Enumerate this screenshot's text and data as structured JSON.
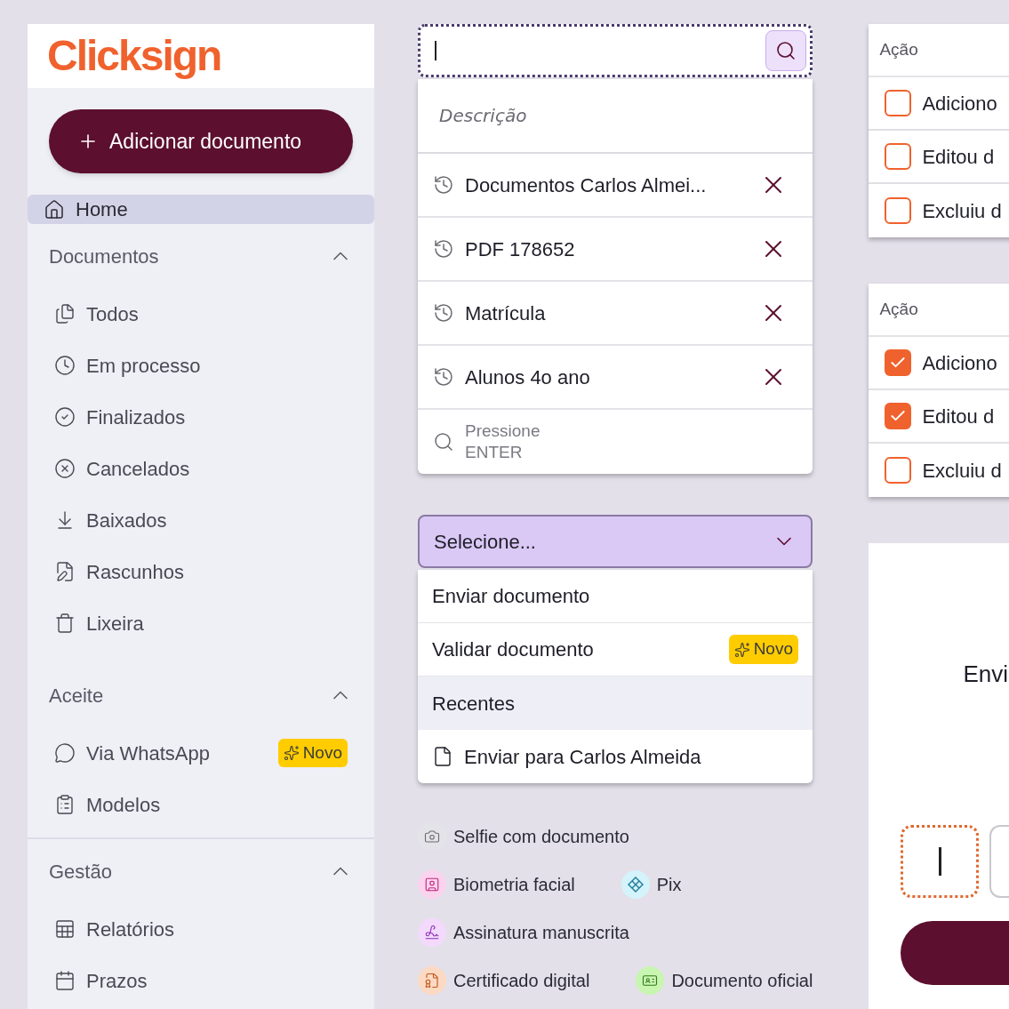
{
  "sidebar": {
    "logo": "Clicksign",
    "add_button": "Adicionar documento",
    "home": {
      "label": "Home",
      "selected": true
    },
    "sections": [
      {
        "title": "Documentos",
        "expanded": true,
        "items": [
          {
            "label": "Todos",
            "selected": false
          },
          {
            "label": "Em processo",
            "selected": false
          },
          {
            "label": "Finalizados",
            "selected": false
          },
          {
            "label": "Cancelados",
            "selected": false
          },
          {
            "label": "Baixados",
            "selected": false
          },
          {
            "label": "Rascunhos",
            "selected": false
          },
          {
            "label": "Lixeira",
            "selected": false
          }
        ]
      },
      {
        "title": "Aceite",
        "expanded": true,
        "items": [
          {
            "label": "Via WhatsApp",
            "selected": false,
            "badge": "Novo"
          },
          {
            "label": "Modelos",
            "selected": false
          }
        ]
      },
      {
        "title": "Gestão",
        "expanded": true,
        "items": [
          {
            "label": "Relatórios",
            "selected": false
          },
          {
            "label": "Prazos",
            "selected": false
          }
        ]
      }
    ]
  },
  "search": {
    "description": "Descrição",
    "recent": [
      {
        "text": "Documentos Carlos Almei..."
      },
      {
        "text": "PDF 178652"
      },
      {
        "text": "Matrícula"
      },
      {
        "text": "Alunos 4o ano"
      }
    ],
    "hint": "Pressione ENTER"
  },
  "select": {
    "placeholder": "Selecione...",
    "expanded": true,
    "options": [
      {
        "kind": "option",
        "label": "Enviar documento"
      },
      {
        "kind": "option",
        "label": "Validar documento",
        "badge": "Novo"
      },
      {
        "kind": "header",
        "label": "Recentes"
      },
      {
        "kind": "file",
        "label": "Enviar para Carlos Almeida"
      }
    ]
  },
  "auth_methods": [
    [
      {
        "label": "Selfie com documento",
        "color": "#e4e4e8"
      }
    ],
    [
      {
        "label": "Biometria facial",
        "color": "#fbd3ee"
      },
      {
        "label": "Pix",
        "color": "#d4f3fa"
      }
    ],
    [
      {
        "label": "Assinatura manuscrita",
        "color": "#f3d9fb"
      }
    ],
    [
      {
        "label": "Certificado digital",
        "color": "#fcd9c2"
      },
      {
        "label": "Documento oficial",
        "color": "#c8f5b0"
      }
    ]
  ],
  "action_tables": [
    {
      "header": "Ação",
      "rows": [
        {
          "text": "Adiciono",
          "checked": false
        },
        {
          "text": "Editou d",
          "checked": false
        },
        {
          "text": "Excluiu d",
          "checked": false
        }
      ]
    },
    {
      "header": "Ação",
      "rows": [
        {
          "text": "Adiciono",
          "checked": true
        },
        {
          "text": "Editou d",
          "checked": true
        },
        {
          "text": "Excluiu d",
          "checked": false
        }
      ]
    }
  ],
  "send_card": {
    "title": "Envi"
  }
}
